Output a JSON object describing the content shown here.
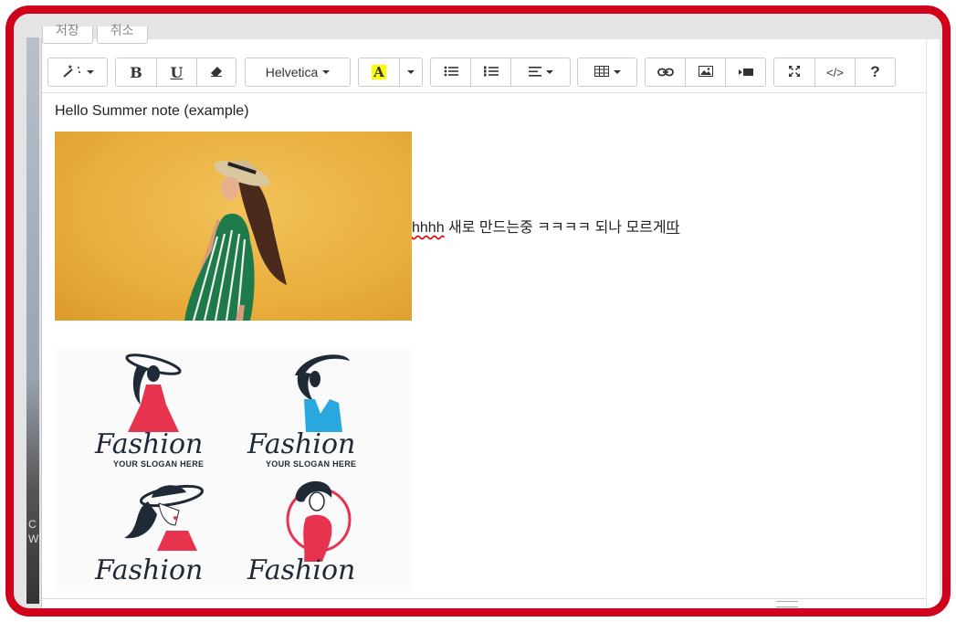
{
  "tabs": [
    "저장",
    "취소"
  ],
  "toolbar": {
    "style_icon": "magic-wand-icon",
    "bold_label": "B",
    "underline_label": "U",
    "eraser_icon": "eraser-icon",
    "font_name": "Helvetica",
    "color_label": "A",
    "color_accent": "#ffff00",
    "ul_icon": "unordered-list-icon",
    "ol_icon": "ordered-list-icon",
    "align_icon": "align-left-icon",
    "table_icon": "table-icon",
    "link_icon": "link-icon",
    "picture_icon": "picture-icon",
    "video_icon": "video-icon",
    "fullscreen_icon": "fullscreen-icon",
    "code_label": "</>",
    "help_label": "?"
  },
  "content": {
    "heading": "Hello Summer note (example)",
    "inline_prefix": "hhhh",
    "inline_middle": " 새로 만드는중 ㅋㅋㅋㅋ 되나 모르게",
    "inline_end": "따"
  },
  "logos": {
    "slogan": "YOUR SLOGAN HERE",
    "word": "Fashion"
  },
  "left_strip_text": [
    "C",
    "W"
  ],
  "colors": {
    "frame": "#d0021b",
    "dress_pink": "#e8334f",
    "dress_blue": "#29a8e0",
    "dark": "#1f2a36"
  }
}
